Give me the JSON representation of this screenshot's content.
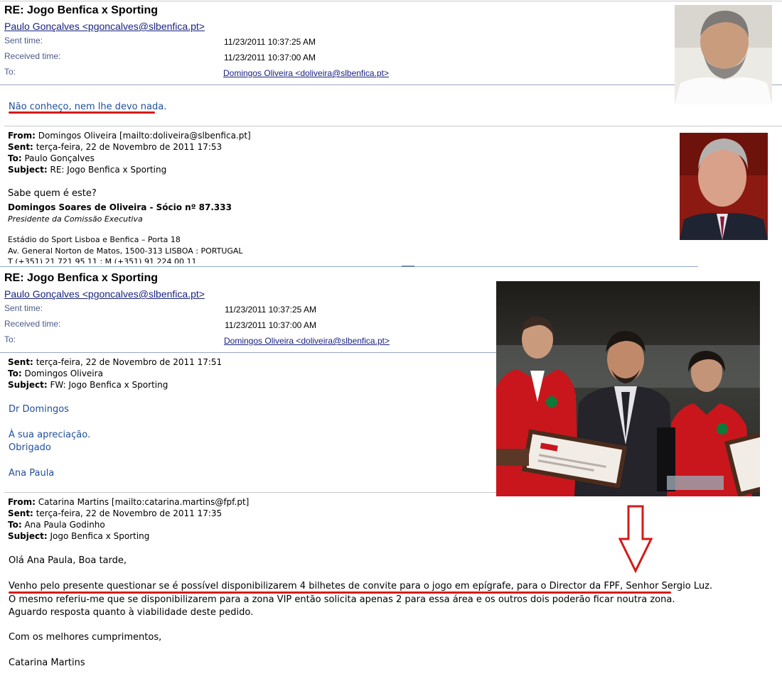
{
  "email1": {
    "subject": "RE: Jogo Benfica x Sporting",
    "from": "Paulo Gonçalves <pgoncalves@slbenfica.pt>",
    "sent_label": "Sent time:",
    "sent_value": "11/23/2011 10:37:25 AM",
    "received_label": "Received time:",
    "received_value": "11/23/2011 10:37:00 AM",
    "to_label": "To:",
    "to_value": "Domingos Oliveira <doliveira@slbenfica.pt>",
    "reply": "Não conheço, nem lhe devo nada.",
    "quoted": {
      "from_label": "From:",
      "from_value": "Domingos Oliveira [mailto:doliveira@slbenfica.pt]",
      "sent_label": "Sent:",
      "sent_value": "terça-feira, 22 de Novembro de 2011 17:53",
      "to_label": "To:",
      "to_value": "Paulo Gonçalves",
      "subject_label": "Subject:",
      "subject_value": "RE: Jogo Benfica x Sporting",
      "line1": "Sabe quem é este?",
      "signature_name": "Domingos Soares de Oliveira - Sócio nº 87.333",
      "signature_title": "Presidente da Comissão Executiva",
      "address1": "Estádio do Sport Lisboa e Benfica – Porta 18",
      "address2": "Av. General Norton de Matos, 1500-313 LISBOA : PORTUGAL",
      "phone": "T (+351) 21 721 95 11 ; M (+351) 91 224 00 11"
    }
  },
  "email2": {
    "subject": "RE: Jogo Benfica x Sporting",
    "from": "Paulo Gonçalves <pgoncalves@slbenfica.pt>",
    "sent_label": "Sent time:",
    "sent_value": "11/23/2011 10:37:25 AM",
    "received_label": "Received time:",
    "received_value": "11/23/2011 10:37:00 AM",
    "to_label": "To:",
    "to_value": "Domingos Oliveira <doliveira@slbenfica.pt>",
    "fw": {
      "sent_label": "Sent:",
      "sent_value": "terça-feira, 22 de Novembro de 2011 17:51",
      "to_label": "To:",
      "to_value": "Domingos Oliveira",
      "subject_label": "Subject:",
      "subject_value": "FW: Jogo Benfica x Sporting",
      "greeting": "Dr Domingos",
      "line1": "À sua apreciação.",
      "line2": "Obrigado",
      "sign": "Ana Paula"
    },
    "orig": {
      "from_label": "From:",
      "from_value": "Catarina Martins [mailto:catarina.martins@fpf.pt]",
      "sent_label": "Sent:",
      "sent_value": "terça-feira, 22 de Novembro de 2011 17:35",
      "to_label": "To:",
      "to_value": "Ana Paula Godinho",
      "subject_label": "Subject:",
      "subject_value": "Jogo Benfica x Sporting",
      "greeting": "Olá Ana Paula, Boa tarde,",
      "p1": "Venho pelo presente questionar se é possível disponibilizarem 4 bilhetes de convite para o jogo em epígrafe, para o Director da FPF, Senhor Sergio Luz.",
      "p2": "O mesmo referiu-me que se disponibilizarem para a zona VIP então solicita apenas 2 para essa área e os outros dois poderão ficar noutra zona.",
      "p3": "Aguardo resposta quanto à viabilidade deste pedido.",
      "closing": "Com os melhores cumprimentos,",
      "sign": "Catarina Martins"
    }
  },
  "colors": {
    "accent_red": "#d61a1a",
    "link_blue": "#1a237e",
    "body_blue": "#1f4e9b"
  }
}
